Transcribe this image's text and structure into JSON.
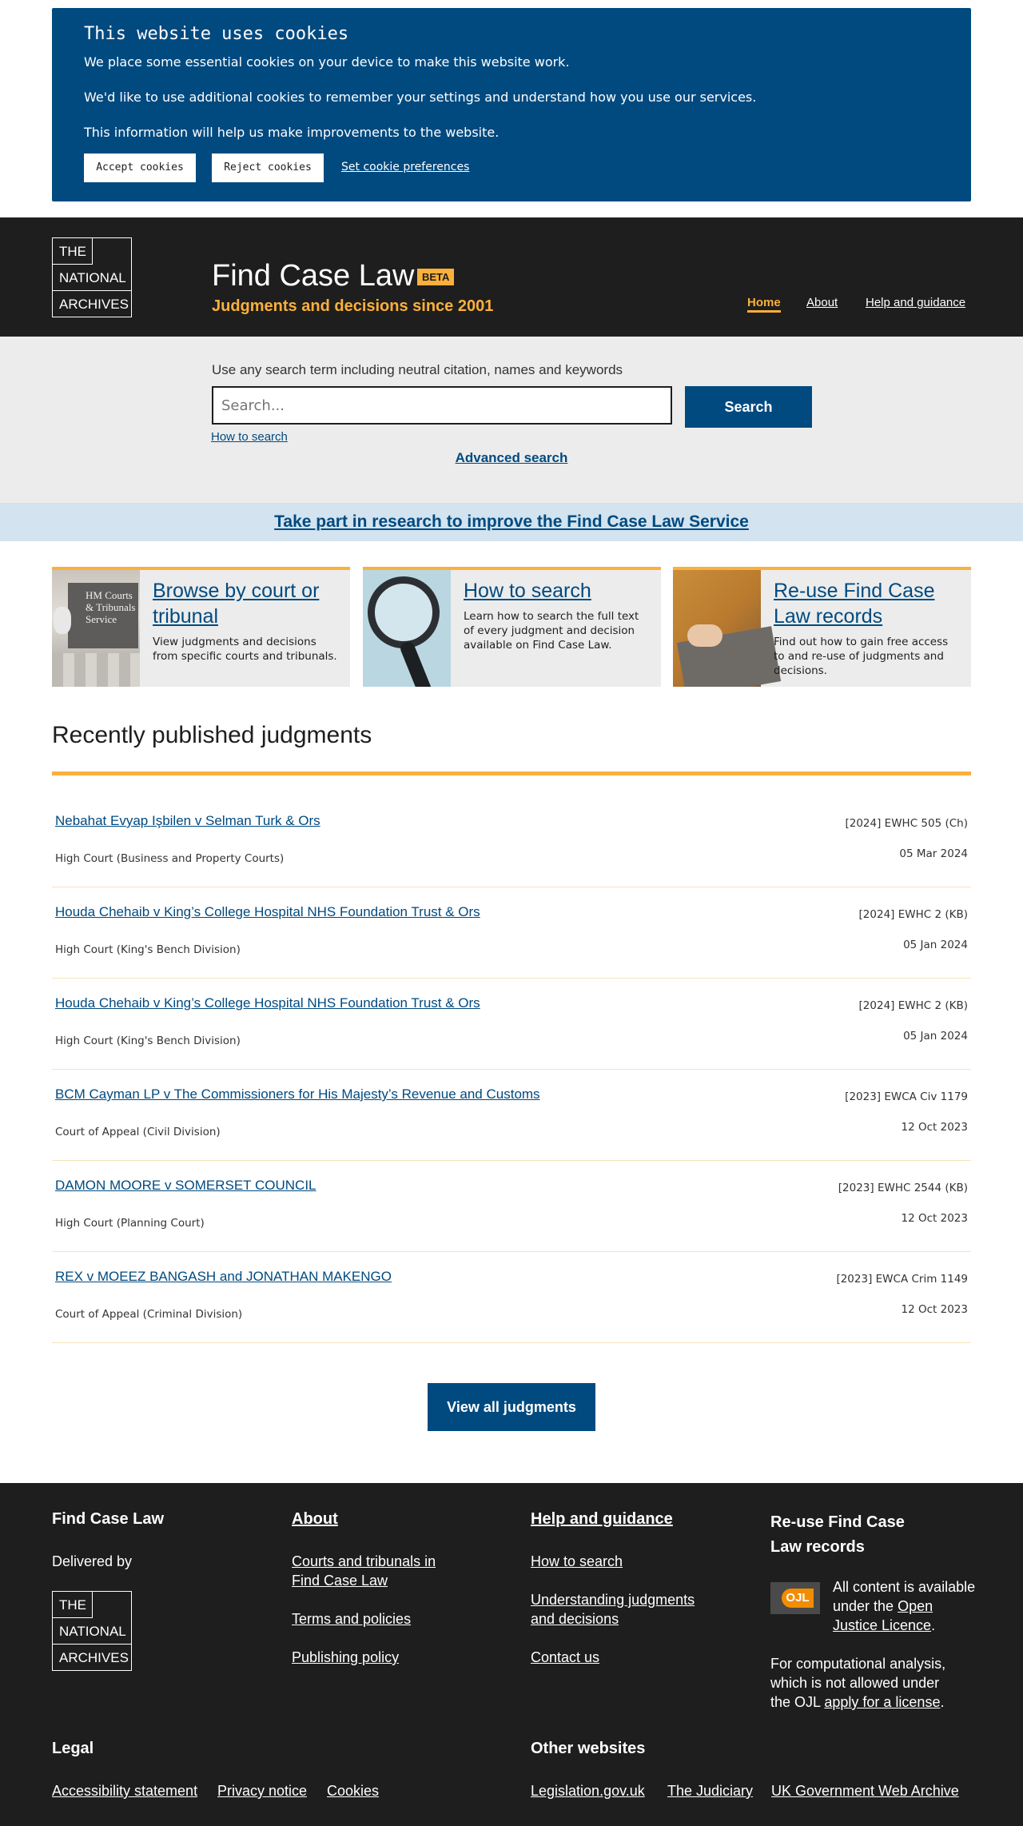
{
  "cookie_banner": {
    "title": "This website uses cookies",
    "line1": "We place some essential cookies on your device to make this website work.",
    "line2": "We'd like to use additional cookies to remember your settings and understand how you use our services.",
    "line3": "This information will help us make improvements to the website.",
    "accept_label": "Accept cookies",
    "reject_label": "Reject cookies",
    "prefs_label": "Set cookie preferences"
  },
  "header": {
    "logo": {
      "line1": "THE",
      "line2": "NATIONAL",
      "line3": "ARCHIVES"
    },
    "title": "Find Case Law",
    "badge": "BETA",
    "subtitle": "Judgments and decisions since 2001",
    "nav": {
      "home": "Home",
      "about": "About",
      "help": "Help and guidance"
    }
  },
  "search": {
    "hint": "Use any search term including neutral citation, names and keywords",
    "placeholder": "Search...",
    "button": "Search",
    "how_link": "How to search",
    "advanced_link": "Advanced search"
  },
  "research_banner": "Take part in research to improve the Find Case Law Service",
  "cards": [
    {
      "title": "Browse by court or tribunal",
      "desc": "View judgments and decisions from specific courts and tribunals.",
      "image_text": "HM Courts & Tribunals Service"
    },
    {
      "title": "How to search",
      "desc": "Learn how to search the full text of every judgment and decision available on Find Case Law."
    },
    {
      "title": "Re-use Find Case Law records",
      "desc": "Find out how to gain free access to and re-use of judgments and decisions."
    }
  ],
  "recent": {
    "heading": "Recently published judgments",
    "items": [
      {
        "title": "Nebahat Evyap Işbilen v Selman Turk & Ors",
        "court": "High Court (Business and Property Courts)",
        "citation": "[2024] EWHC 505 (Ch)",
        "date": "05 Mar 2024"
      },
      {
        "title": "Houda Chehaib v King’s College Hospital NHS Foundation Trust & Ors",
        "court": "High Court (King's Bench Division)",
        "citation": "[2024] EWHC 2 (KB)",
        "date": "05 Jan 2024"
      },
      {
        "title": "Houda Chehaib v King’s College Hospital NHS Foundation Trust & Ors",
        "court": "High Court (King's Bench Division)",
        "citation": "[2024] EWHC 2 (KB)",
        "date": "05 Jan 2024"
      },
      {
        "title": "BCM Cayman LP v The Commissioners for His Majesty’s Revenue and Customs",
        "court": "Court of Appeal (Civil Division)",
        "citation": "[2023] EWCA Civ 1179",
        "date": "12 Oct 2023"
      },
      {
        "title": "DAMON MOORE v SOMERSET COUNCIL",
        "court": "High Court (Planning Court)",
        "citation": "[2023] EWHC 2544 (KB)",
        "date": "12 Oct 2023"
      },
      {
        "title": "REX v MOEEZ BANGASH and JONATHAN MAKENGO",
        "court": "Court of Appeal (Criminal Division)",
        "citation": "[2023] EWCA Crim 1149",
        "date": "12 Oct 2023"
      }
    ],
    "view_all": "View all judgments"
  },
  "footer": {
    "col1_heading": "Find Case Law",
    "delivered_by": "Delivered by",
    "col2_heading": "About",
    "col2_links": [
      "Courts and tribunals in Find Case Law",
      "Terms and policies",
      "Publishing policy"
    ],
    "col3_heading": "Help and guidance",
    "col3_links": [
      "How to search",
      "Understanding judgments and decisions",
      "Contact us"
    ],
    "col4_heading": "Re-use Find Case Law records",
    "ojl_badge": "OJL",
    "ojl_text_before": "All content is available under the ",
    "ojl_link": "Open Justice Licence",
    "ojl_text_after": ".",
    "comp_text": "For computational analysis, which is not allowed under the OJL ",
    "comp_link": "apply for a license",
    "comp_after": ".",
    "legal_heading": "Legal",
    "legal_links": [
      "Accessibility statement",
      "Privacy notice",
      "Cookies"
    ],
    "other_heading": "Other websites",
    "other_links": [
      "Legislation.gov.uk",
      "The Judiciary",
      "UK Government Web Archive"
    ]
  },
  "colors": {
    "brand_blue": "#004a80",
    "accent_yellow": "#fbb03b",
    "dark": "#1e1e1e",
    "light_grey": "#ececec"
  }
}
